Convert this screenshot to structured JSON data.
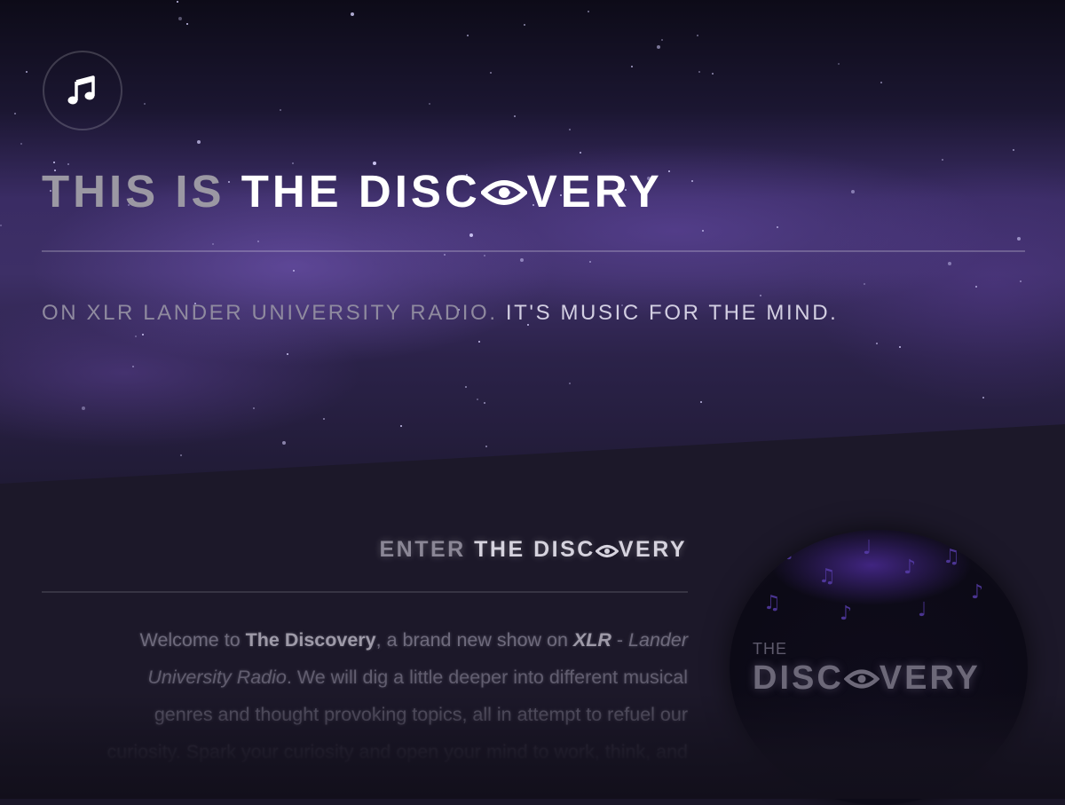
{
  "hero": {
    "logo_icon": "music-note-icon",
    "title_muted": "THIS IS",
    "title_bright_before": "THE DISC",
    "title_eye_icon": "eye-icon",
    "title_bright_after": "VERY",
    "tagline_muted": "ON XLR LANDER UNIVERSITY RADIO.",
    "tagline_bright": "IT'S MUSIC FOR THE MIND."
  },
  "enter": {
    "title_muted": "ENTER",
    "title_bright_before": "THE DISC",
    "title_bright_after": "VERY"
  },
  "description": {
    "line1_pre": "Welcome to ",
    "line1_bold": "The Discovery",
    "line1_mid": ", a brand new show on ",
    "line1_xlr": "XLR",
    "line1_dash": " - ",
    "line1_italic": "Lander",
    "line2_italic": "University Radio",
    "line2_rest": ". We will dig a little deeper into different musical",
    "line3": "genres and thought provoking topics, all in attempt to refuel our",
    "line4": "curiosity. Spark your curiosity and open your mind to work, think, and"
  },
  "cover": {
    "small_text": "THE",
    "big_text_before": "DISC",
    "big_text_after": "VERY"
  },
  "colors": {
    "bright": "#ffffff",
    "muted": "#9b98a3",
    "background_lower": "#1c1829"
  }
}
